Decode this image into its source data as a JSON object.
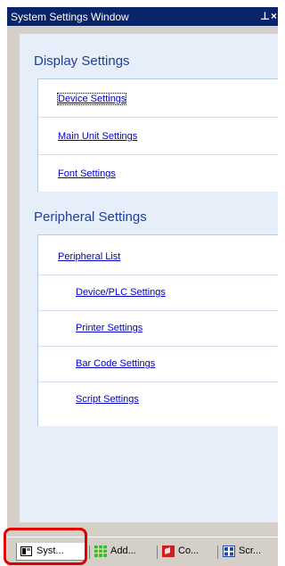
{
  "window": {
    "title": "System Settings Window",
    "pin_glyph": "⊥",
    "close_glyph": "×"
  },
  "display_settings": {
    "title": "Display Settings",
    "links": [
      "Device Settings",
      "Main Unit Settings",
      "Font Settings"
    ]
  },
  "peripheral_settings": {
    "title": "Peripheral Settings",
    "list_link": "Peripheral List",
    "sub_links": [
      "Device/PLC Settings",
      "Printer Settings",
      "Bar Code Settings",
      "Script Settings"
    ]
  },
  "tabs": [
    {
      "label": "Syst...",
      "icon": "system-settings-icon",
      "active": true
    },
    {
      "label": "Add...",
      "icon": "address-grid-icon",
      "active": false
    },
    {
      "label": "Co...",
      "icon": "common-red-icon",
      "active": false
    },
    {
      "label": "Scr...",
      "icon": "screen-list-icon",
      "active": false
    }
  ],
  "colors": {
    "titlebar": "#0a246a",
    "section_title": "#1f3f9b",
    "link": "#0000cc",
    "pane_bg": "#e6eefa",
    "highlight": "#e00000"
  }
}
